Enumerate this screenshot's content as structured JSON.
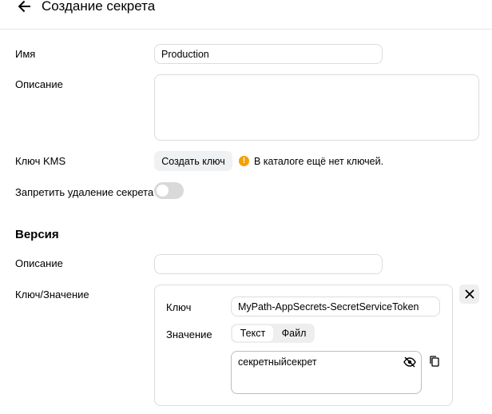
{
  "header": {
    "title": "Создание секрета"
  },
  "form": {
    "name_label": "Имя",
    "name_value": "Production",
    "description_label": "Описание",
    "description_value": "",
    "kms_label": "Ключ KMS",
    "create_key_label": "Создать ключ",
    "kms_warning": "В каталоге ещё нет ключей.",
    "deletion_protection_label": "Запретить удаление секрета",
    "deletion_protection_enabled": false
  },
  "version": {
    "title": "Версия",
    "description_label": "Описание",
    "description_value": "",
    "kv_label": "Ключ/Значение",
    "key_label": "Ключ",
    "key_value": "MyPath-AppSecrets-SecretServiceToken",
    "value_label": "Значение",
    "tab_text": "Текст",
    "tab_file": "Файл",
    "value": "секретныйсекрет"
  },
  "colors": {
    "warning": "#f2a100",
    "toggle_off": "#d9d9d9"
  }
}
